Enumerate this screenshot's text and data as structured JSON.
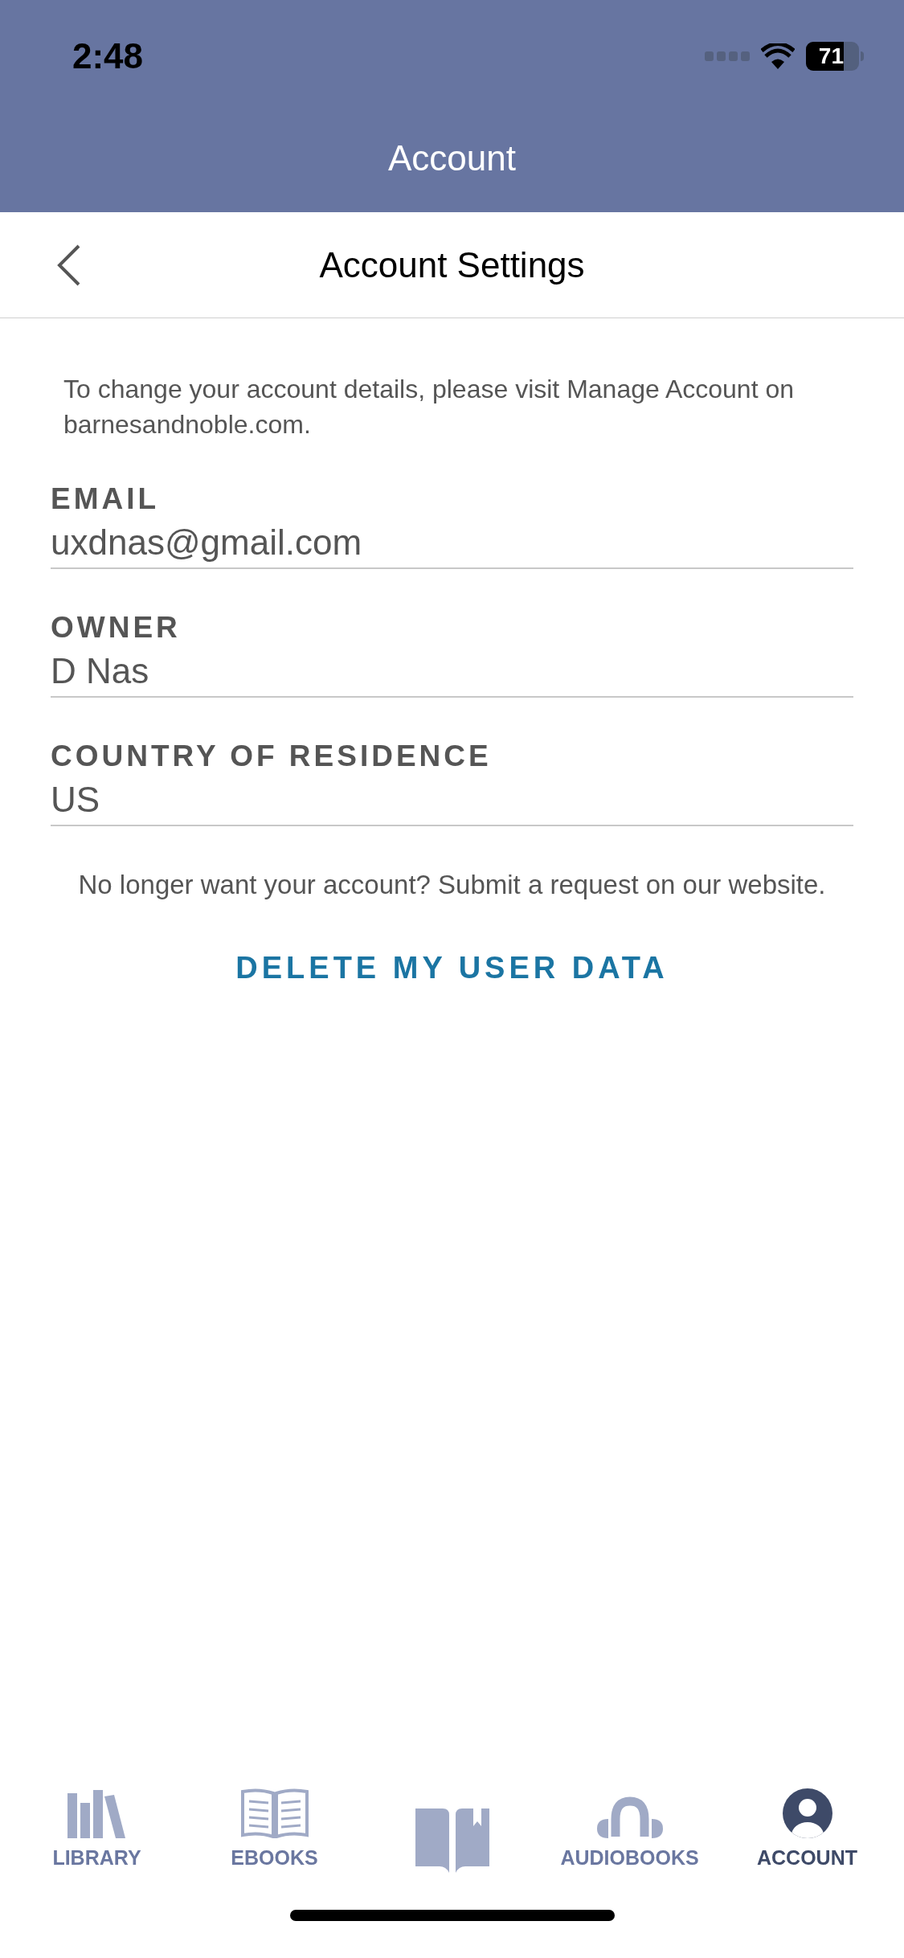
{
  "status_bar": {
    "time": "2:48",
    "battery": "71"
  },
  "header": {
    "title": "Account"
  },
  "nav": {
    "title": "Account Settings"
  },
  "intro": "To change your account details, please visit Manage Account on barnesandnoble.com.",
  "fields": [
    {
      "label": "EMAIL",
      "value": "uxdnas@gmail.com"
    },
    {
      "label": "OWNER",
      "value": "D Nas"
    },
    {
      "label": "COUNTRY OF RESIDENCE",
      "value": "US"
    }
  ],
  "delete_note": "No longer want your account? Submit a request on our website.",
  "delete_link": "DELETE MY USER DATA",
  "tabs": [
    {
      "kind": "library",
      "label": "LIBRARY",
      "selected": false
    },
    {
      "kind": "ebooks",
      "label": "EBOOKS",
      "selected": false
    },
    {
      "kind": "reading",
      "selected": false
    },
    {
      "kind": "audiobooks",
      "label": "AUDIOBOOKS",
      "selected": false
    },
    {
      "kind": "account",
      "label": "ACCOUNT",
      "selected": true
    }
  ]
}
